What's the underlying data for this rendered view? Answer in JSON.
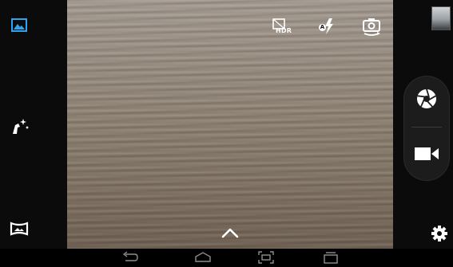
{
  "top_controls": {
    "hdr_label": "HDR",
    "flash_mode_letter": "A"
  },
  "icons": {
    "gallery": "gallery-icon",
    "effects": "effects-wand-icon",
    "panorama": "panorama-icon",
    "hdr": "hdr-off-icon",
    "flash": "flash-auto-icon",
    "switch_camera": "switch-camera-icon",
    "thumbnail": "last-photo-thumbnail",
    "shutter": "shutter-icon",
    "video": "video-camera-icon",
    "settings": "settings-gear-icon",
    "expand": "chevron-up-icon",
    "nav_back": "back-icon",
    "nav_home": "home-icon",
    "nav_screenshot": "screenshot-icon",
    "nav_recents": "recents-icon"
  },
  "colors": {
    "accent": "#2ea3f2",
    "icon": "#ffffff",
    "nav_icon": "#8e8e8e"
  }
}
